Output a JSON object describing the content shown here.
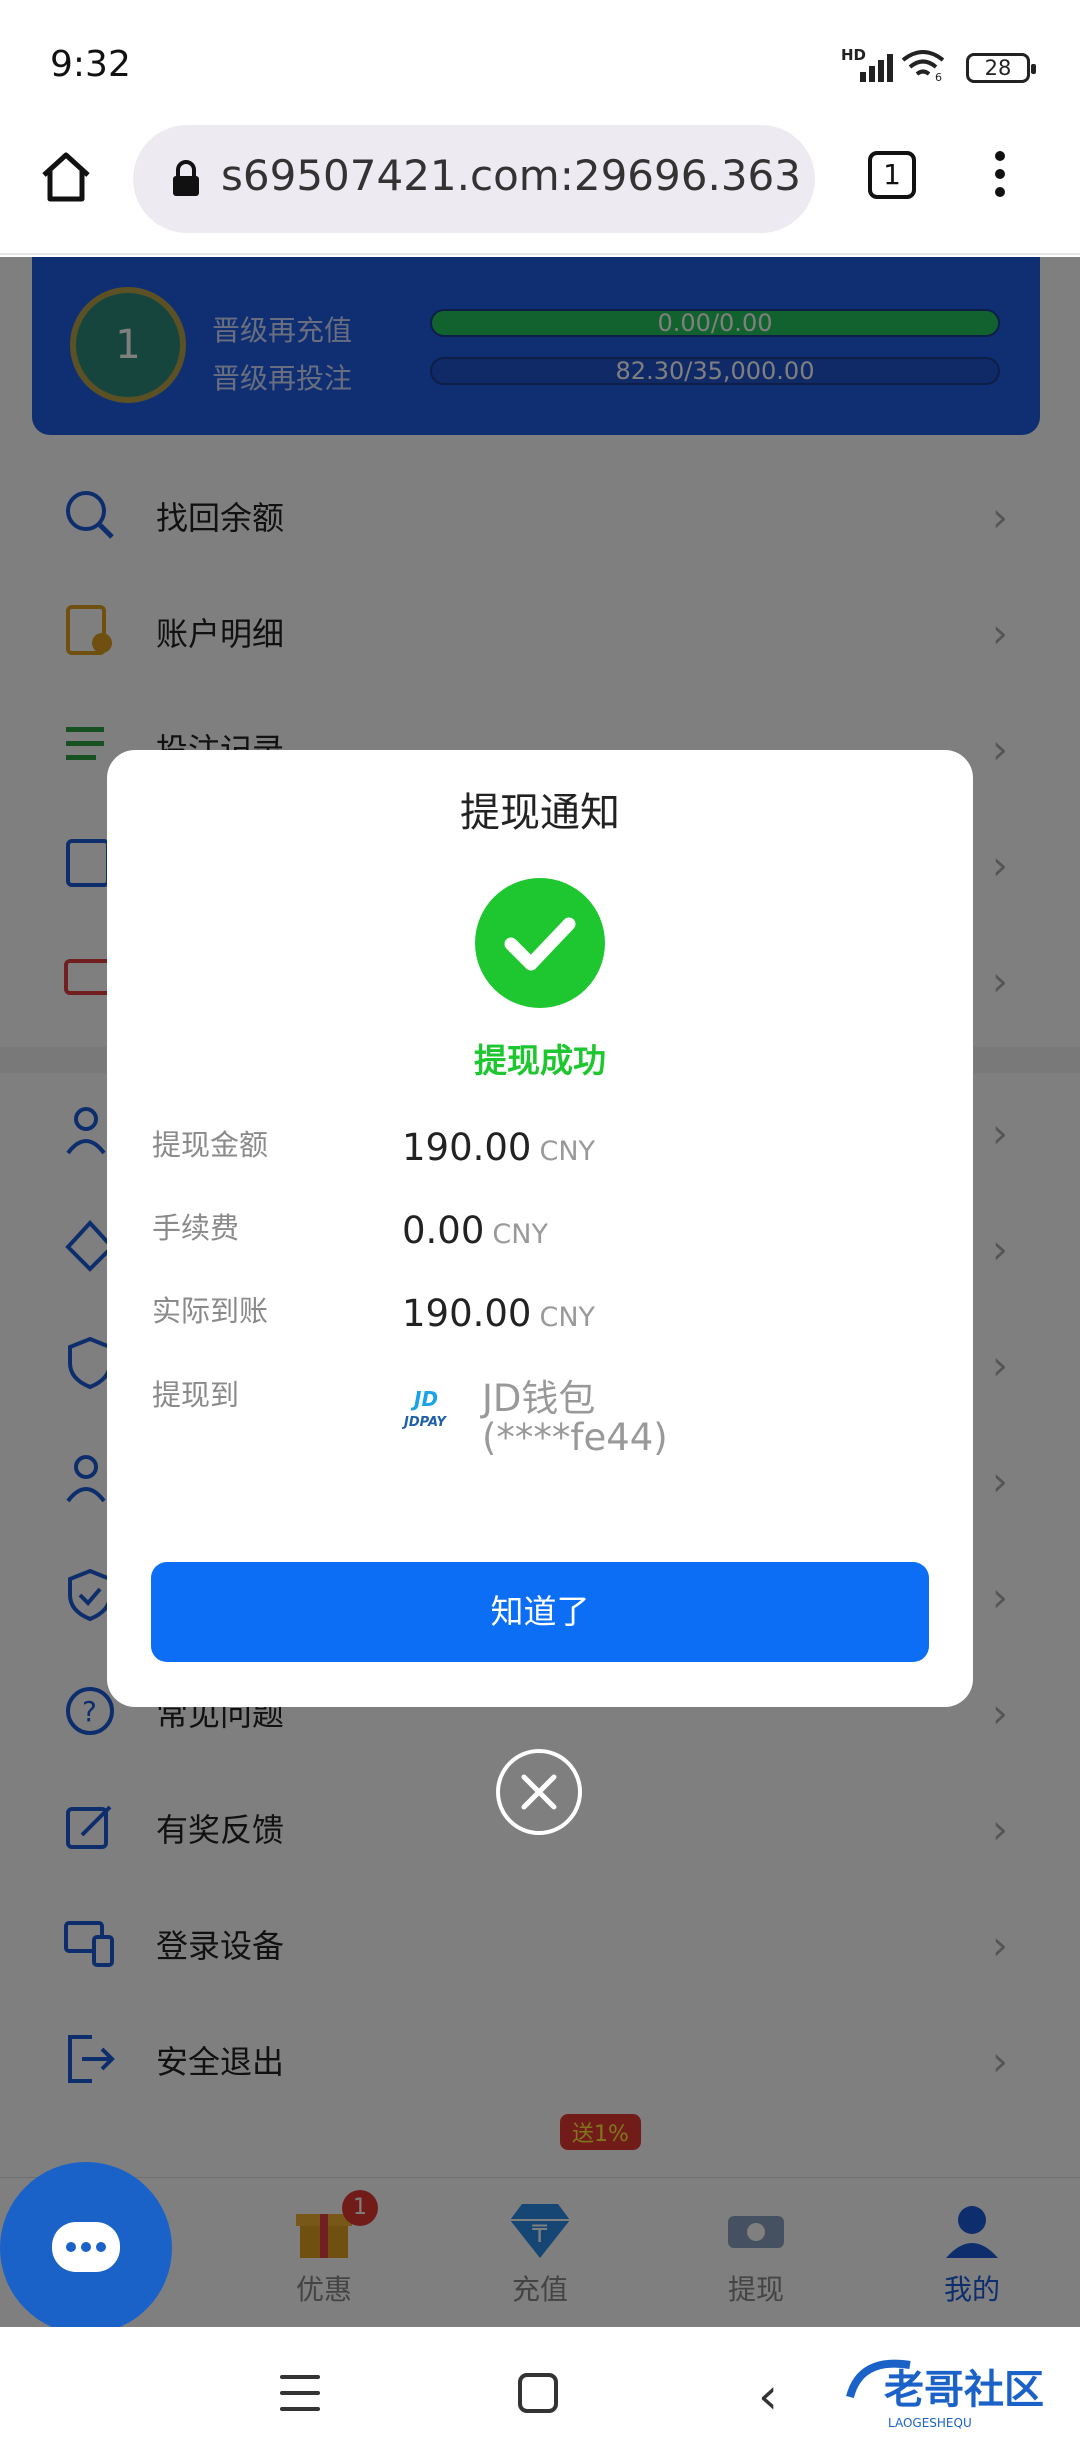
{
  "status_bar": {
    "time": "9:32",
    "network": "HD",
    "wifi_sub": "6",
    "battery": "28"
  },
  "browser": {
    "url": "363.ws69507421.com:29696",
    "tab_count": "1"
  },
  "vip": {
    "badge_level": "1",
    "row1_label": "晋级再充值",
    "row1_value": "0.00/0.00",
    "row2_label": "晋级再投注",
    "row2_value": "82.30/35,000.00",
    "row2_progress": 0.0024
  },
  "menu": {
    "group1": [
      "找回余额",
      "账户明细",
      "投注记录",
      "",
      ""
    ],
    "group2": [
      "",
      "",
      "",
      "",
      "",
      "常见问题",
      "有奖反馈",
      "登录设备",
      "安全退出"
    ]
  },
  "bottom_nav": {
    "items": [
      {
        "label": "优惠",
        "badge": "1"
      },
      {
        "label": "充值",
        "promo": "送1%"
      },
      {
        "label": "提现"
      },
      {
        "label": "我的"
      }
    ]
  },
  "dialog": {
    "title": "提现通知",
    "status": "提现成功",
    "amount_label": "提现金额",
    "amount": "190.00",
    "fee_label": "手续费",
    "fee": "0.00",
    "actual_label": "实际到账",
    "actual": "190.00",
    "currency": "CNY",
    "dest_label": "提现到",
    "dest_logo": "JDPAY",
    "dest_name": "JD钱包",
    "dest_account": "(****fe44)",
    "button": "知道了"
  },
  "colors": {
    "accent": "#0b6ef5",
    "success": "#1ec72f",
    "vip_card": "#1f5fe5"
  },
  "watermark": {
    "title": "老哥社区",
    "sub": "LAOGESHEQU"
  }
}
